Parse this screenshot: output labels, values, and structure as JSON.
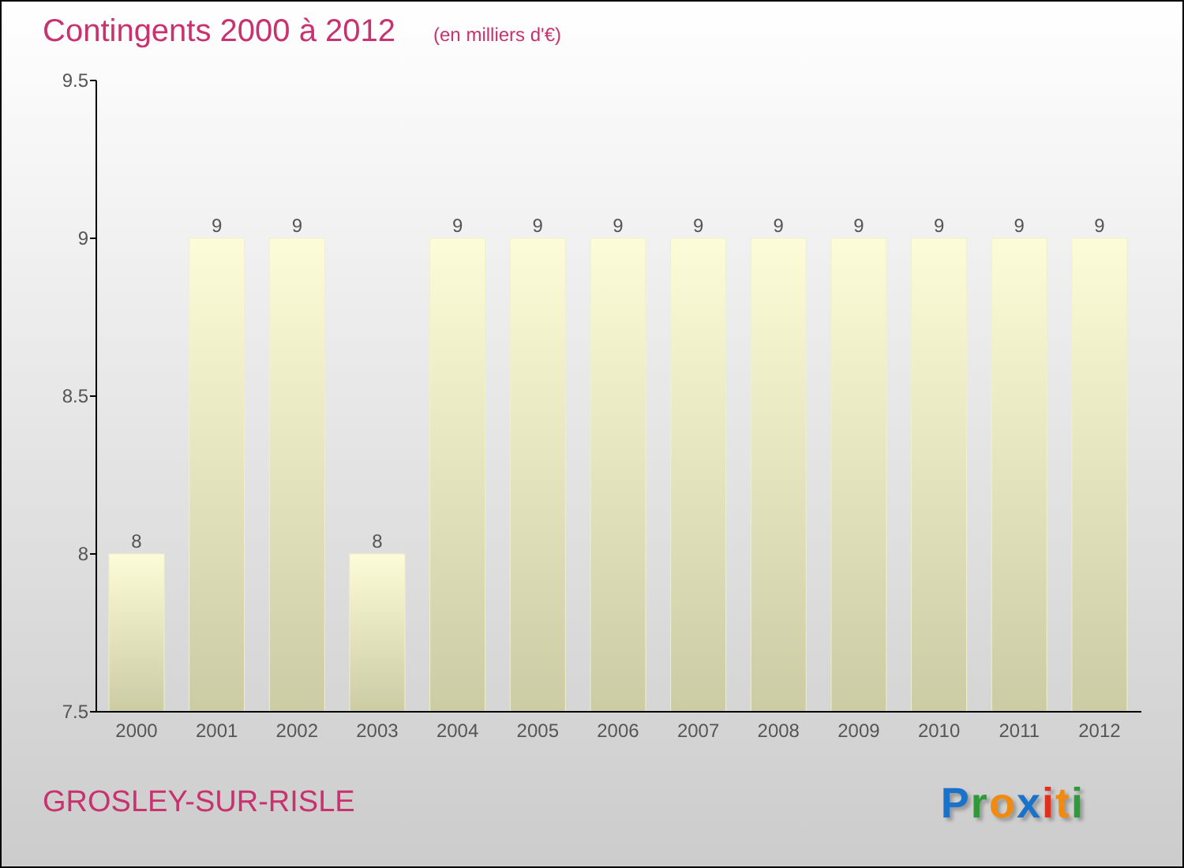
{
  "title": "Contingents 2000 à 2012",
  "subtitle": "(en milliers d'€)",
  "chart_data": {
    "type": "bar",
    "categories": [
      "2000",
      "2001",
      "2002",
      "2003",
      "2004",
      "2005",
      "2006",
      "2007",
      "2008",
      "2009",
      "2010",
      "2011",
      "2012"
    ],
    "series": [
      {
        "color": "#f0f0c8",
        "values": [
          8,
          9,
          9,
          8,
          9,
          9,
          9,
          9,
          9,
          9,
          9,
          9,
          9
        ]
      }
    ],
    "ylim": [
      7.5,
      9.5
    ],
    "yticks": [
      7.5,
      8,
      8.5,
      9,
      9.5
    ],
    "data_labels": true
  },
  "place": "GROSLEY-SUR-RISLE",
  "logo": [
    {
      "text": "P",
      "color": "#1a73c8"
    },
    {
      "text": "r",
      "color": "#2e9a3a"
    },
    {
      "text": "o",
      "color": "#f08a10"
    },
    {
      "text": "x",
      "color": "#1a73c8"
    },
    {
      "text": "i",
      "color": "#e0301e"
    },
    {
      "text": "t",
      "color": "#f08a10"
    },
    {
      "text": "i",
      "color": "#2e9a3a"
    }
  ]
}
